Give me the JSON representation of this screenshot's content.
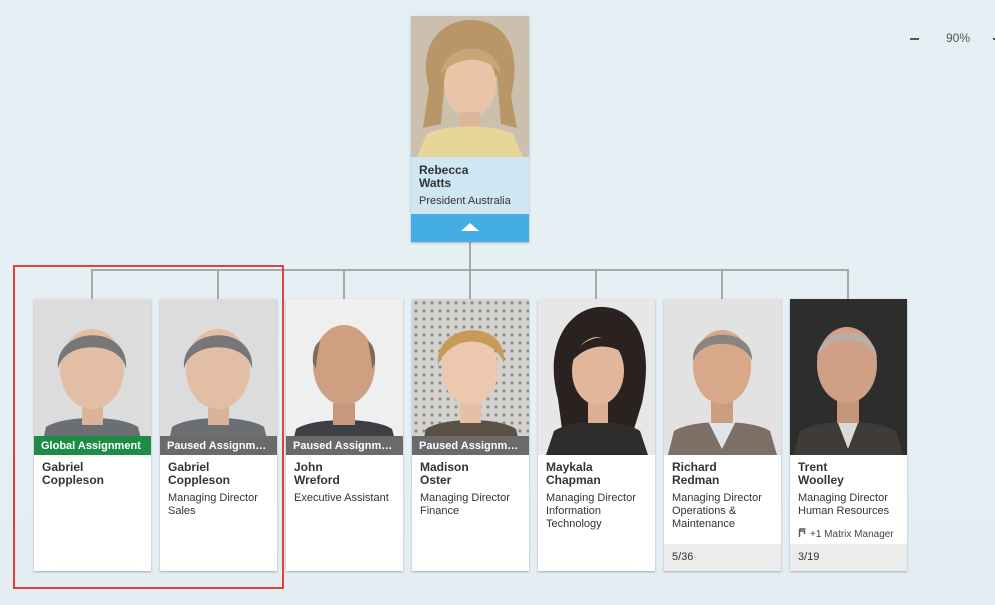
{
  "zoom": {
    "value": "90%"
  },
  "root": {
    "first": "Rebecca",
    "last": "Watts",
    "title": "President Australia"
  },
  "reports": [
    {
      "badge": "Global Assignment",
      "first": "Gabriel",
      "last": "Coppleson",
      "title": ""
    },
    {
      "badge": "Paused Assignme…",
      "first": "Gabriel",
      "last": "Coppleson",
      "title": "Managing Director Sales"
    },
    {
      "badge": "Paused Assignme…",
      "first": "John",
      "last": "Wreford",
      "title": "Executive Assistant"
    },
    {
      "badge": "Paused Assignme…",
      "first": "Madison",
      "last": "Oster",
      "title": "Managing Director Finance"
    },
    {
      "first": "Maykala",
      "last": "Chapman",
      "title": "Managing Director Information Technology"
    },
    {
      "first": "Richard",
      "last": "Redman",
      "title": "Managing Director Operations & Maintenance",
      "count": "5/36"
    },
    {
      "first": "Trent",
      "last": "Woolley",
      "title": "Managing Director Human Resources",
      "matrix": "+1 Matrix Manager",
      "count": "3/19"
    }
  ],
  "colors": {
    "accent": "#44ade4",
    "global_badge": "#1e8c45",
    "paused_badge": "#6a6a6a",
    "highlight": "#e0413d"
  }
}
